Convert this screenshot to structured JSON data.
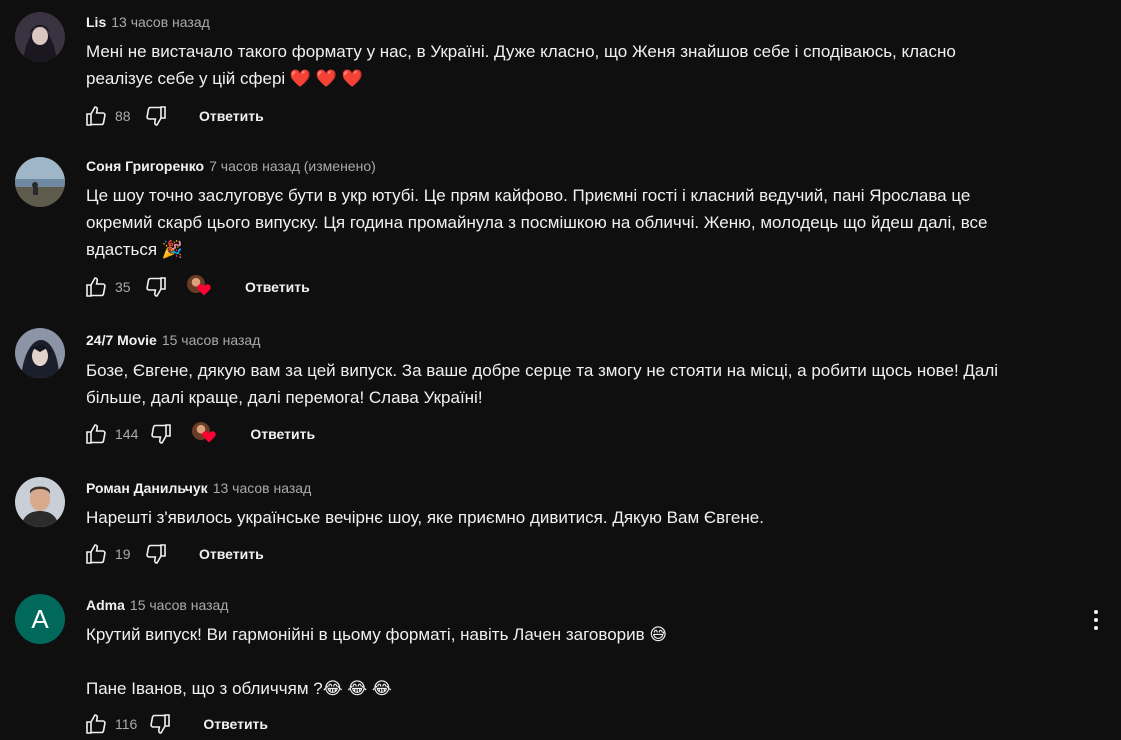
{
  "comments": [
    {
      "author": "Lis",
      "time": "13 часов назад",
      "text": "Мені не вистачало такого формату у нас, в Україні. Дуже класно, що Женя знайшов себе і сподіваюсь, класно\nреалізує себе у цій сфері ❤️ ❤️ ❤️",
      "likes": "88",
      "reply_label": "Ответить"
    },
    {
      "author": "Соня Григоренко",
      "time": "7 часов назад (изменено)",
      "text": "Це шоу точно заслуговує бути в укр ютубі. Це прям кайфово. Приємні гості і класний ведучий, пані Ярослава це\nокремий скарб цього випуску. Ця година промайнула з посмішкою на обличчі. Женю, молодець що йдеш далі, все\nвдасться 🎉",
      "likes": "35",
      "reply_label": "Ответить"
    },
    {
      "author": "24/7 Movie",
      "time": "15 часов назад",
      "text": "Бозе, Євгене, дякую вам за цей випуск. За ваше добре серце та змогу не стояти на місці, а робити щось нове! Далі\nбільше, далі краще, далі перемога! Слава Україні!",
      "likes": "144",
      "reply_label": "Ответить"
    },
    {
      "author": "Роман Данильчук",
      "time": "13 часов назад",
      "text": "Нарешті з'явилось українське вечірнє шоу, яке приємно дивитися. Дякую Вам Євгене.",
      "likes": "19",
      "reply_label": "Ответить"
    },
    {
      "author": "Adma",
      "avatar_letter": "A",
      "time": "15 часов назад",
      "text": "Крутий випуск! Ви гармонійні в цьому форматі, навіть Лачен заговорив 😅\n\nПане Іванов, що з обличчям ?😂 😂 😂",
      "likes": "116",
      "reply_label": "Ответить"
    }
  ],
  "colors": {
    "background": "#0f0f0f",
    "text": "#f1f1f1",
    "secondary_text": "#aaaaaa",
    "heart": "#ff0033",
    "letter_avatar": "#00695c"
  }
}
